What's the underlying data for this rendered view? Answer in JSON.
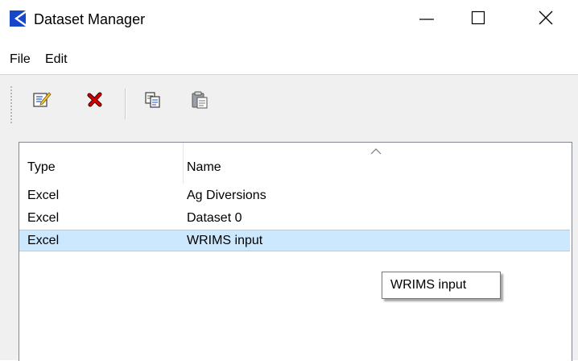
{
  "window": {
    "title": "Dataset Manager",
    "app_icon": "app-logo-icon",
    "controls": {
      "minimize_icon": "minimize-icon",
      "maximize_icon": "maximize-icon",
      "close_icon": "close-icon"
    }
  },
  "menubar": {
    "items": [
      {
        "label": "File"
      },
      {
        "label": "Edit"
      }
    ]
  },
  "toolbar": {
    "buttons": [
      {
        "icon": "edit-icon"
      },
      {
        "icon": "delete-icon"
      },
      {
        "icon": "copy-icon"
      },
      {
        "icon": "paste-icon"
      }
    ]
  },
  "table": {
    "columns": [
      "Type",
      "Name"
    ],
    "sort_indicator": "sort-ascending-icon",
    "rows": [
      {
        "type": "Excel",
        "name": "Ag Diversions",
        "selected": false
      },
      {
        "type": "Excel",
        "name": "Dataset 0",
        "selected": false
      },
      {
        "type": "Excel",
        "name": "WRIMS input",
        "selected": true
      }
    ]
  },
  "tooltip": {
    "text": "WRIMS input"
  },
  "colors": {
    "selection_bg": "#cce8ff",
    "selection_border": "#99d1ff",
    "app_icon_blue": "#1747c9",
    "delete_red": "#d40000"
  }
}
